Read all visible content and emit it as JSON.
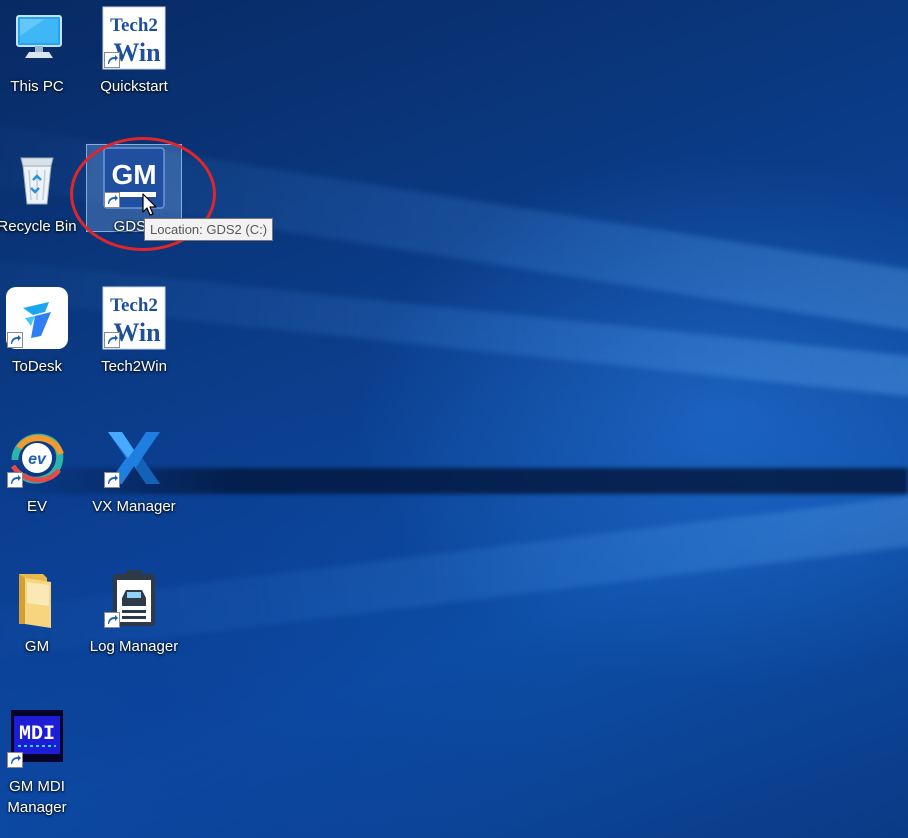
{
  "desktop": {
    "icons": [
      {
        "id": "this-pc",
        "label": "This PC",
        "icon": "monitor-icon"
      },
      {
        "id": "quickstart",
        "label": "Quickstart",
        "icon": "tech2win-icon"
      },
      {
        "id": "recycle-bin",
        "label": "Recycle Bin",
        "icon": "recycle-bin-icon"
      },
      {
        "id": "gds2",
        "label": "GDS2",
        "icon": "gm-logo-icon"
      },
      {
        "id": "todesk",
        "label": "ToDesk",
        "icon": "todesk-icon"
      },
      {
        "id": "tech2win",
        "label": "Tech2Win",
        "icon": "tech2win-icon"
      },
      {
        "id": "ev",
        "label": "EV",
        "icon": "ev-icon"
      },
      {
        "id": "vx-manager",
        "label": "VX Manager",
        "icon": "vx-icon"
      },
      {
        "id": "gm-folder",
        "label": "GM",
        "icon": "folder-icon"
      },
      {
        "id": "log-manager",
        "label": "Log Manager",
        "icon": "clipboard-car-icon"
      },
      {
        "id": "gm-mdi-manager",
        "label": "GM MDI Manager",
        "icon": "mdi-icon"
      }
    ],
    "gm_logo_text": "GM",
    "tech2win_logo": {
      "line1": "Tech2",
      "line2": "Win"
    },
    "mdi_logo_text": "MDI",
    "ev_logo_text": "ev"
  },
  "tooltip": {
    "text": "Location: GDS2 (C:)"
  },
  "colors": {
    "annotation_circle": "#e0262d",
    "selection": "#78aae6",
    "gm_blue": "#1f4f9e",
    "tech2win_blue": "#1d4f9a"
  }
}
